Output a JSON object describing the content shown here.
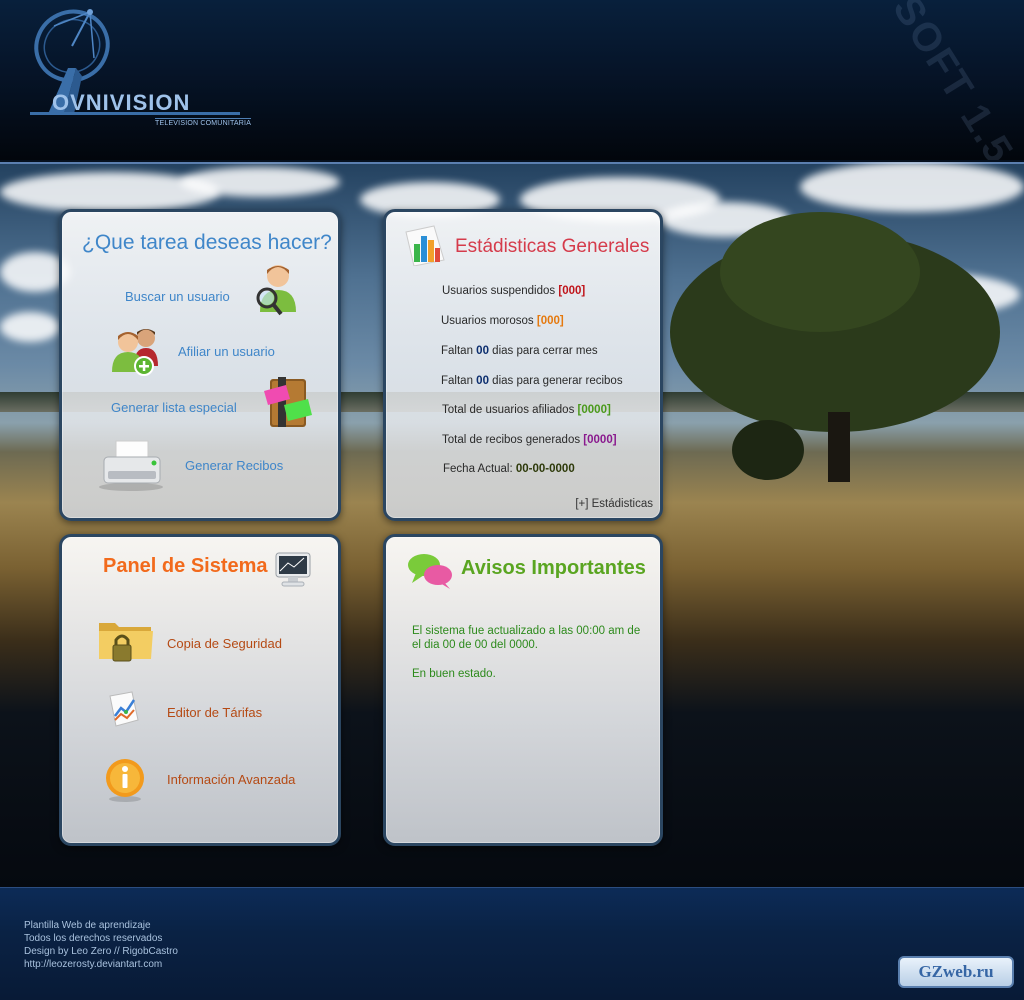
{
  "header": {
    "logo_text": "OVNIVISION",
    "logo_subtitle": "TELEVISION COMUNITARIA",
    "version_watermark": "SOFT 1.5"
  },
  "tasks_panel": {
    "title": "¿Que tarea deseas hacer?",
    "items": [
      {
        "label": "Buscar un usuario",
        "icon": "user-search-icon"
      },
      {
        "label": "Afiliar un usuario",
        "icon": "users-add-icon"
      },
      {
        "label": "Generar lista especial",
        "icon": "notes-icon"
      },
      {
        "label": "Generar Recibos",
        "icon": "printer-icon"
      }
    ]
  },
  "stats_panel": {
    "title": "Estádisticas Generales",
    "icon": "bar-chart-icon",
    "rows": [
      {
        "label": "Usuarios suspendidos",
        "value": "[000]"
      },
      {
        "label": "Usuarios morosos",
        "value": "[000]"
      },
      {
        "prefix": "Faltan",
        "value": "00",
        "suffix": "dias para cerrar mes"
      },
      {
        "prefix": "Faltan",
        "value": "00",
        "suffix": "dias para generar recibos"
      },
      {
        "label": "Total de usuarios afiliados",
        "value": "[0000]"
      },
      {
        "label": "Total de recibos generados",
        "value": "[0000]"
      },
      {
        "label": "Fecha Actual:",
        "value": "00-00-0000"
      }
    ],
    "more_link": "[+] Estádisticas"
  },
  "system_panel": {
    "title": "Panel de Sistema",
    "icon": "monitor-icon",
    "items": [
      {
        "label": "Copia de Seguridad",
        "icon": "folder-lock-icon"
      },
      {
        "label": "Editor de Tárifas",
        "icon": "chart-document-icon"
      },
      {
        "label": "Información Avanzada",
        "icon": "info-icon"
      }
    ]
  },
  "notices_panel": {
    "title": "Avisos Importantes",
    "icon": "chat-bubbles-icon",
    "message_1": "El sistema fue actualizado a las 00:00 am de el dia 00 de 00 del 0000.",
    "message_2": "En buen estado."
  },
  "footer": {
    "lines": [
      "Plantilla Web de aprendizaje",
      "Todos los derechos reservados",
      "Design by Leo Zero // RigobCastro",
      "http://leozerosty.deviantart.com"
    ],
    "badge": "GZweb.ru"
  },
  "colors": {
    "header_bg": "#061428",
    "accent_blue": "#3f86c9",
    "stats_title": "#d53b4b",
    "system_title": "#f26a1c",
    "notices_title": "#5aa521",
    "link_brown": "#b54a14",
    "footer_bg": "#0a2244"
  }
}
